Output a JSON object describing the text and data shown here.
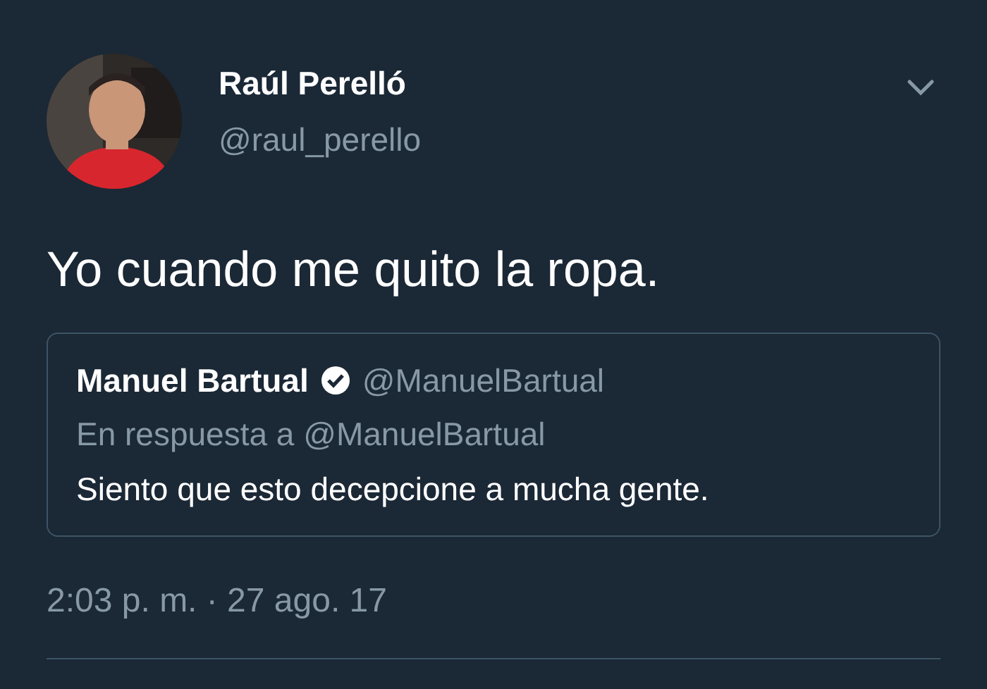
{
  "tweet": {
    "name": "Raúl Perelló",
    "handle": "@raul_perello",
    "text": "Yo cuando me quito la ropa.",
    "timestamp": "2:03 p. m. · 27 ago. 17"
  },
  "quote": {
    "name": "Manuel Bartual",
    "verified": true,
    "handle": "@ManuelBartual",
    "reply_to": "En respuesta a @ManuelBartual",
    "text": "Siento que esto decepcione a mucha gente."
  }
}
